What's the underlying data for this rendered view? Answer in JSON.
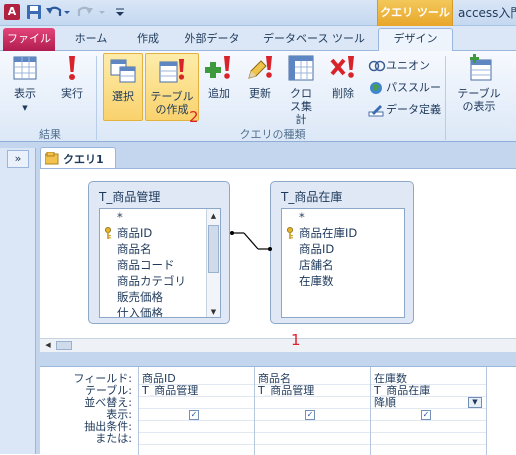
{
  "title_bar": {
    "app_icon": "A",
    "context_tab_title": "クエリ ツール",
    "window_title": "access入門"
  },
  "tabs": [
    "ファイル",
    "ホーム",
    "作成",
    "外部データ",
    "データベース ツール",
    "デザイン"
  ],
  "active_tab": "デザイン",
  "ribbon": {
    "results_group": {
      "label": "結果",
      "buttons": [
        {
          "label": "表示",
          "icon": "datasheet-view-icon"
        },
        {
          "label": "実行",
          "icon": "run-exclamation-icon"
        }
      ]
    },
    "query_type_group": {
      "label": "クエリの種類",
      "buttons": [
        {
          "label": "選択",
          "icon": "select-query-icon"
        },
        {
          "label": "テーブルの作成",
          "icon": "make-table-icon"
        },
        {
          "label": "追加",
          "icon": "append-icon"
        },
        {
          "label": "更新",
          "icon": "update-pencil-icon"
        },
        {
          "label": "クロス集計",
          "icon": "crosstab-icon"
        },
        {
          "label": "削除",
          "icon": "delete-x-icon"
        }
      ],
      "small_buttons": [
        {
          "label": "ユニオン",
          "icon": "union-rings-icon"
        },
        {
          "label": "パススルー",
          "icon": "globe-icon"
        },
        {
          "label": "データ定義",
          "icon": "data-definition-icon"
        }
      ]
    },
    "show_table_button": {
      "label": "テーブルの表示",
      "icon": "show-table-icon"
    }
  },
  "annotations": {
    "marker_1": "1",
    "marker_2": "2"
  },
  "nav_pane": {
    "toggle": "»"
  },
  "document_tab": {
    "label": "クエリ1",
    "icon": "query-tab-icon"
  },
  "tables": [
    {
      "name": "T_商品管理",
      "fields": [
        "*",
        "商品ID",
        "商品名",
        "商品コード",
        "商品カテゴリ",
        "販売価格",
        "仕入価格"
      ],
      "primary_key": "商品ID"
    },
    {
      "name": "T_商品在庫",
      "fields": [
        "*",
        "商品在庫ID",
        "商品ID",
        "店舗名",
        "在庫数"
      ],
      "primary_key": "商品在庫ID"
    }
  ],
  "grid": {
    "row_labels": [
      "フィールド:",
      "テーブル:",
      "並べ替え:",
      "表示:",
      "抽出条件:",
      "または:"
    ],
    "columns": [
      {
        "field": "商品ID",
        "table": "T_商品管理",
        "sort": "",
        "show": true
      },
      {
        "field": "商品名",
        "table": "T_商品管理",
        "sort": "",
        "show": true
      },
      {
        "field": "在庫数",
        "table": "T_商品在庫",
        "sort": "降順",
        "show": true
      }
    ]
  }
}
